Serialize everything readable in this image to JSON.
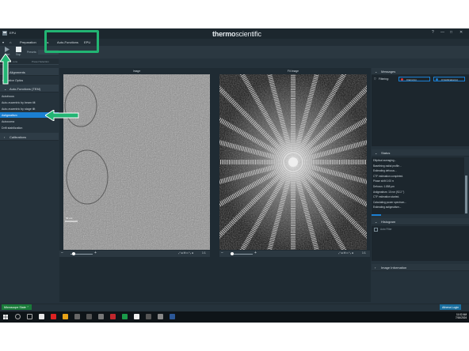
{
  "window": {
    "title": "EPU",
    "brand_a": "thermo",
    "brand_b": "scientific"
  },
  "window_controls": {
    "help": "?",
    "minimize": "—",
    "maximize": "□",
    "close": "✕"
  },
  "menu": {
    "items": [
      "Preparation",
      "Auto-Functions",
      "EPU"
    ],
    "hidden_item": "tas"
  },
  "toolbar": {
    "start_label": "Start",
    "stop_label": "Stop",
    "presets_label": "Presets:",
    "presets_value": ""
  },
  "subtabs": [
    "...ions",
    "Preset Selection"
  ],
  "sidebar": {
    "alignments_label": "Alignments",
    "optics_label": "Objective Optics",
    "auto_functions_label": "Auto-Functions (TEM)",
    "items": [
      "Autofocus",
      "Auto-eucentric by beam tilt",
      "Auto-eucentric by stage tilt",
      "Astigmatism",
      "Autocoma",
      "Drift stabilization"
    ],
    "selected_index": 3,
    "calibrations_label": "Calibrations"
  },
  "image_panel": {
    "title": "Image",
    "scalebar": "50 nm"
  },
  "fft_panel": {
    "title": "Fit Image"
  },
  "zoom_controls": {
    "minus": "−",
    "plus": "+",
    "fit": "1:1"
  },
  "messages": {
    "title": "Messages",
    "filtering_label": "Filtering:",
    "errors": "0 Error(s)",
    "notifications": "0 Notification(s)"
  },
  "status_panel": {
    "title": "Status",
    "lines": [
      "Elliptical averaging...",
      "Baselining radial profile...",
      "Estimating defocus...",
      "CTF estimation completed.",
      "Phase shift 0.00 π",
      "Defocus: 1.858 µm",
      "Astigmatism: 10 nm (92.2 °)",
      "CTF estimation started.",
      "Calculating power spectrum...",
      "Estimating astigmatism..."
    ]
  },
  "histogram": {
    "title": "Histogram",
    "auto_filter": "Auto Filter"
  },
  "image_info": {
    "title": "Image Information"
  },
  "statusbar": {
    "microscope_state": "Microscope State",
    "athena_login": "Athena Login"
  },
  "taskbar": {
    "time": "11:02 AM",
    "date": "7/16/2024"
  },
  "colors": {
    "app_bg": "#25323b",
    "selection": "#1b7fd1",
    "annotation": "#22b573"
  }
}
